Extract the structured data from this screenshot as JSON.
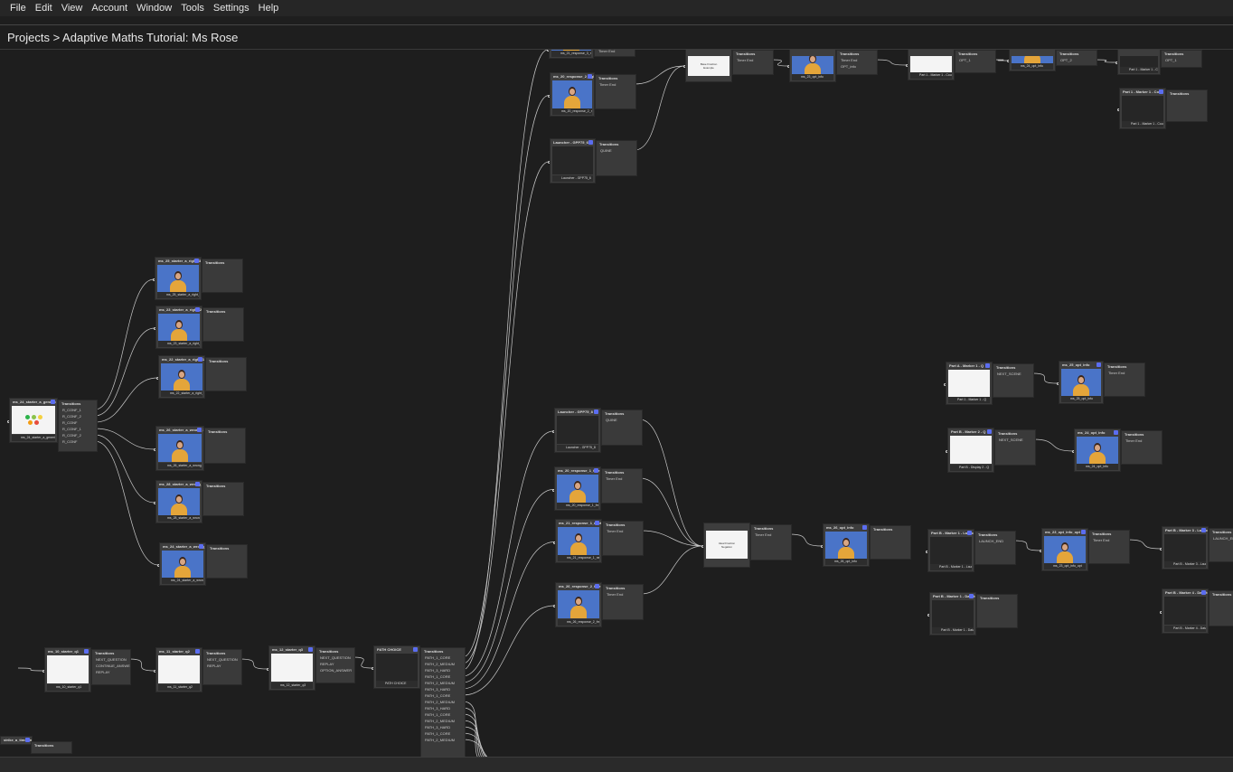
{
  "menu": [
    "File",
    "Edit",
    "View",
    "Account",
    "Window",
    "Tools",
    "Settings",
    "Help"
  ],
  "breadcrumb": "Projects > Adaptive Maths Tutorial: Ms Rose",
  "transitions_label": "Transitions",
  "nodes": [
    {
      "id": "n1",
      "title": "ms_21_response_3_res",
      "thumb": "blue",
      "foot": "ms_21_response_3_res",
      "trans": [
        "Timer End"
      ]
    },
    {
      "id": "n2",
      "title": "ms_20_response_2_right",
      "thumb": "blue",
      "foot": "ms_20_response_2_ri",
      "trans": [
        "Timer End"
      ]
    },
    {
      "id": "n3",
      "title": "Launcher - GPP75_6",
      "thumb": "blank",
      "foot": "Launcher - GPP75_6",
      "trans": [
        "QUINE"
      ]
    },
    {
      "id": "n4",
      "title": "",
      "thumb": "white",
      "slide": "Base Fraction Example",
      "foot": "",
      "trans": [
        "Timer End"
      ]
    },
    {
      "id": "n5",
      "title": "",
      "thumb": "blue",
      "foot": "ms_23_opt_info",
      "trans": [
        "Timer End",
        "OPT_info"
      ]
    },
    {
      "id": "n6",
      "title": "",
      "thumb": "white",
      "slide": "",
      "foot": "Part 1 - Marker 1 - Coun",
      "trans": [
        "OPT_1"
      ]
    },
    {
      "id": "n7",
      "title": "",
      "thumb": "blue",
      "foot": "ms_24_opt_info",
      "trans": [
        "OPT_2"
      ]
    },
    {
      "id": "n8",
      "title": "",
      "thumb": "blank",
      "foot": "Part 1 - Marker 1 - Coun",
      "trans": [
        "OPT_1"
      ]
    },
    {
      "id": "n9",
      "title": "Part 1 - Marker 1 - Coun",
      "thumb": "blank",
      "foot": "Part 1 - Marker 1 - Coun",
      "trans": []
    },
    {
      "id": "n10",
      "title": "ms_24_starter_a_generic",
      "thumb": "white",
      "foot": "ms_24_starter_a_generic",
      "trans": [
        "R_CONF_1",
        "R_CONF_2",
        "R_CONF",
        "R_CONF_1",
        "R_CONF_2",
        "R_CONF"
      ]
    },
    {
      "id": "n11",
      "title": "ms_25_starter_a_right_3",
      "thumb": "blue",
      "foot": "ms_25_starter_a_right_3",
      "trans": []
    },
    {
      "id": "n12",
      "title": "ms_23_starter_a_right_2",
      "thumb": "blue",
      "foot": "ms_23_starter_a_right_2",
      "trans": []
    },
    {
      "id": "n13",
      "title": "ms_22_starter_a_right_1",
      "thumb": "blue",
      "foot": "ms_22_starter_a_right_1",
      "trans": []
    },
    {
      "id": "n14",
      "title": "ms_26_starter_a_wrong_1",
      "thumb": "blue",
      "foot": "ms_26_starter_a_wrong_1",
      "trans": []
    },
    {
      "id": "n15",
      "title": "ms_28_starter_a_wrong_2",
      "thumb": "blue",
      "foot": "ms_28_starter_a_wrong_2",
      "trans": []
    },
    {
      "id": "n16",
      "title": "ms_24_starter_a_wrong_3",
      "thumb": "blue",
      "foot": "ms_24_starter_a_wrong_3",
      "trans": []
    },
    {
      "id": "n17",
      "title": "Launcher - GPP75_8",
      "thumb": "blank",
      "foot": "Launcher - GPP75_8",
      "trans": [
        "QUINE"
      ]
    },
    {
      "id": "n18",
      "title": "ms_20_response_1_free",
      "thumb": "blue",
      "foot": "ms_20_response_1_free",
      "trans": [
        "Timer End"
      ]
    },
    {
      "id": "n19",
      "title": "ms_21_response_1_next",
      "thumb": "blue",
      "foot": "ms_21_response_1_next",
      "trans": [
        "Timer End"
      ]
    },
    {
      "id": "n20",
      "title": "ms_26_response_2_free",
      "thumb": "blue",
      "foot": "ms_26_response_2_free",
      "trans": [
        "Timer End"
      ]
    },
    {
      "id": "n21",
      "title": "",
      "thumb": "white",
      "slide": "Ideal Fraction Negation",
      "foot": "",
      "trans": [
        "Timer End"
      ]
    },
    {
      "id": "n22",
      "title": "ms_26_opt_info",
      "thumb": "blue",
      "foot": "ms_26_opt_info",
      "trans": []
    },
    {
      "id": "n23",
      "title": "Part A - Marker 1 - Q",
      "thumb": "white",
      "foot": "Part 1 - Marker 1 - Q",
      "trans": [
        "NEXT_SCENE"
      ]
    },
    {
      "id": "n24",
      "title": "ms_25_opt_info",
      "thumb": "blue",
      "foot": "ms_25_opt_info",
      "trans": [
        "Timer End"
      ]
    },
    {
      "id": "n25",
      "title": "Part B - Marker 2 - Q",
      "thumb": "white",
      "foot": "Part B - Display 2 - Q",
      "trans": [
        "NEXT_SCENE"
      ]
    },
    {
      "id": "n26",
      "title": "ms_24_opt_info",
      "thumb": "blue",
      "foot": "ms_24_opt_info",
      "trans": [
        "Timer End"
      ]
    },
    {
      "id": "n27",
      "title": "Part B - Marker 1 - Launch",
      "thumb": "blank",
      "foot": "Part B - Marker 1 - Laun",
      "trans": [
        "LAUNCH_END"
      ]
    },
    {
      "id": "n28",
      "title": "ms_23_opt_info_opt",
      "thumb": "blue",
      "foot": "ms_23_opt_info_opt",
      "trans": [
        "Timer End"
      ]
    },
    {
      "id": "n29",
      "title": "Part B - Marker 3 - Launc",
      "thumb": "blank",
      "foot": "Part B - Marker 3 - Laun",
      "trans": [
        "LAUNCH_END"
      ]
    },
    {
      "id": "n30",
      "title": "Part B - Marker 1 - Data ts",
      "thumb": "blank",
      "foot": "Part B - Marker 1 - Data",
      "trans": []
    },
    {
      "id": "n31",
      "title": "Part B - Marker 4 - Data ts",
      "thumb": "blank",
      "foot": "Part B - Marker 4 - Data",
      "trans": []
    },
    {
      "id": "n32",
      "title": "ms_10_starter_q1",
      "thumb": "white",
      "foot": "ms_10_starter_q1",
      "trans": [
        "NEXT_QUESTION",
        "CONTINUE_ANSWER",
        "REPLAY"
      ]
    },
    {
      "id": "n33",
      "title": "ms_11_starter_q2",
      "thumb": "white",
      "foot": "ms_11_starter_q2",
      "trans": [
        "NEXT_QUESTION",
        "REPLAY"
      ]
    },
    {
      "id": "n34",
      "title": "ms_12_starter_q3",
      "thumb": "white",
      "foot": "ms_12_starter_q3",
      "trans": [
        "NEXT_QUESTION",
        "REPLAY",
        "OPTION_ANSWER"
      ]
    },
    {
      "id": "n35",
      "title": "PATH CHOICE",
      "thumb": "blank",
      "foot": "PATH CHOICE",
      "trans": [
        "PATH_1_CORE",
        "PATH_2_MEDIUM",
        "PATH_3_HARD",
        "PATH_1_CORE",
        "PATH_2_MEDIUM",
        "PATH_3_HARD",
        "PATH_1_CORE",
        "PATH_2_MEDIUM",
        "PATH_3_HARD",
        "PATH_1_CORE",
        "PATH_2_MEDIUM",
        "PATH_3_HARD",
        "PATH_1_CORE",
        "PATH_2_MEDIUM"
      ]
    },
    {
      "id": "n36",
      "title": "strike_a_time_ms",
      "thumb": "none",
      "foot": "",
      "trans": []
    }
  ]
}
